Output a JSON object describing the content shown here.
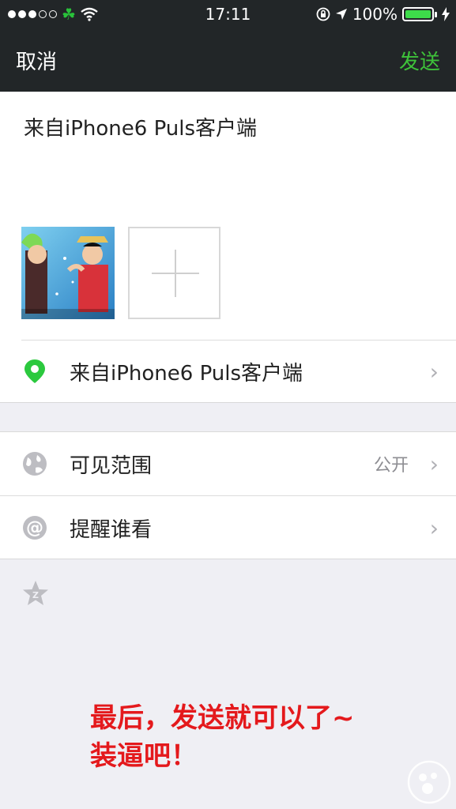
{
  "status_bar": {
    "time": "17:11",
    "battery_percent": "100%",
    "signal_icon": "signal-dots-icon",
    "carrier_icon": "clover-icon",
    "wifi_icon": "wifi-icon",
    "lock_icon": "rotation-lock-icon",
    "location_icon": "location-arrow-icon",
    "battery_icon": "battery-icon",
    "charging_icon": "bolt-icon"
  },
  "nav": {
    "cancel_label": "取消",
    "send_label": "发送",
    "send_color": "#3ec23a"
  },
  "compose": {
    "text": "来自iPhone6 Puls客户端",
    "add_photo_icon": "plus-icon"
  },
  "location_row": {
    "label": "来自iPhone6 Puls客户端",
    "icon": "location-pin-icon",
    "icon_color": "#2bc93e"
  },
  "visibility_row": {
    "label": "可见范围",
    "value": "公开",
    "icon": "globe-icon"
  },
  "mention_row": {
    "label": "提醒谁看",
    "icon": "at-icon"
  },
  "qzone_icon": "qzone-star-icon",
  "annotation": {
    "line1": "最后，发送就可以了~",
    "line2": "装逼吧！",
    "color": "#e4191c"
  }
}
